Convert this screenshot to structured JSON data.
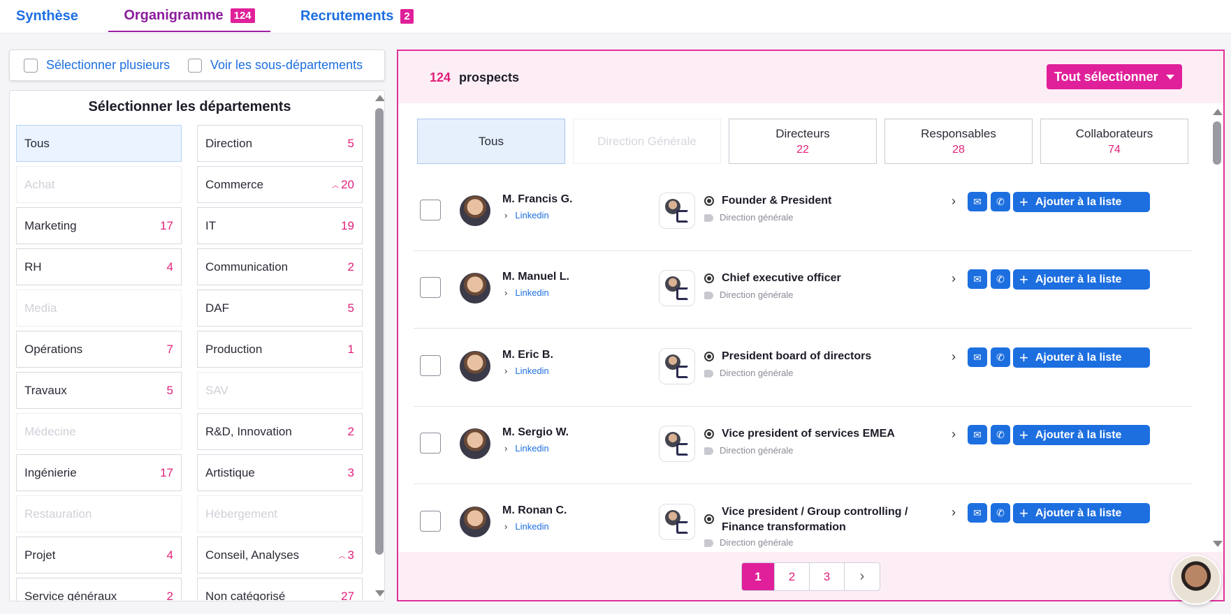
{
  "tabs": [
    {
      "label": "Synthèse",
      "badge": ""
    },
    {
      "label": "Organigramme",
      "badge": "124"
    },
    {
      "label": "Recrutements",
      "badge": "2"
    }
  ],
  "options": {
    "select_multiple": "Sélectionner plusieurs",
    "show_subdepartments": "Voir les sous-départements"
  },
  "departments": {
    "title": "Sélectionner les départements",
    "items": [
      {
        "label": "Tous",
        "count": ""
      },
      {
        "label": "Direction",
        "count": "5"
      },
      {
        "label": "Achat",
        "count": ""
      },
      {
        "label": "Commerce",
        "count": "20"
      },
      {
        "label": "Marketing",
        "count": "17"
      },
      {
        "label": "IT",
        "count": "19"
      },
      {
        "label": "RH",
        "count": "4"
      },
      {
        "label": "Communication",
        "count": "2"
      },
      {
        "label": "Media",
        "count": ""
      },
      {
        "label": "DAF",
        "count": "5"
      },
      {
        "label": "Opérations",
        "count": "7"
      },
      {
        "label": "Production",
        "count": "1"
      },
      {
        "label": "Travaux",
        "count": "5"
      },
      {
        "label": "SAV",
        "count": ""
      },
      {
        "label": "Médecine",
        "count": ""
      },
      {
        "label": "R&D, Innovation",
        "count": "2"
      },
      {
        "label": "Ingénierie",
        "count": "17"
      },
      {
        "label": "Artistique",
        "count": "3"
      },
      {
        "label": "Restauration",
        "count": ""
      },
      {
        "label": "Hébergement",
        "count": ""
      },
      {
        "label": "Projet",
        "count": "4"
      },
      {
        "label": "Conseil, Analyses",
        "count": "3"
      },
      {
        "label": "Service généraux",
        "count": "2"
      },
      {
        "label": "Non catégorisé",
        "count": "27"
      }
    ]
  },
  "prospects": {
    "count": "124",
    "label": "prospects",
    "select_all": "Tout sélectionner",
    "filters": [
      {
        "label": "Tous",
        "count": ""
      },
      {
        "label": "Direction Générale",
        "count": ""
      },
      {
        "label": "Directeurs",
        "count": "22"
      },
      {
        "label": "Responsables",
        "count": "28"
      },
      {
        "label": "Collaborateurs",
        "count": "74"
      }
    ],
    "link_label": "Linkedin",
    "add_label": "Ajouter à la liste",
    "rows": [
      {
        "name": "M. Francis G.",
        "title": "Founder & President",
        "department": "Direction générale"
      },
      {
        "name": "M. Manuel L.",
        "title": "Chief executive officer",
        "department": "Direction générale"
      },
      {
        "name": "M. Eric B.",
        "title": "President board of directors",
        "department": "Direction générale"
      },
      {
        "name": "M. Sergio W.",
        "title": "Vice president of services EMEA",
        "department": "Direction générale"
      },
      {
        "name": "M. Ronan C.",
        "title": "Vice president / Group controlling / Finance transformation",
        "department": "Direction générale"
      }
    ]
  },
  "pagination": {
    "pages": [
      "1",
      "2",
      "3"
    ],
    "next": "›"
  },
  "colors": {
    "accent": "#e0209a",
    "primary": "#1d6fe0",
    "tab_active": "#8b1c9c"
  }
}
